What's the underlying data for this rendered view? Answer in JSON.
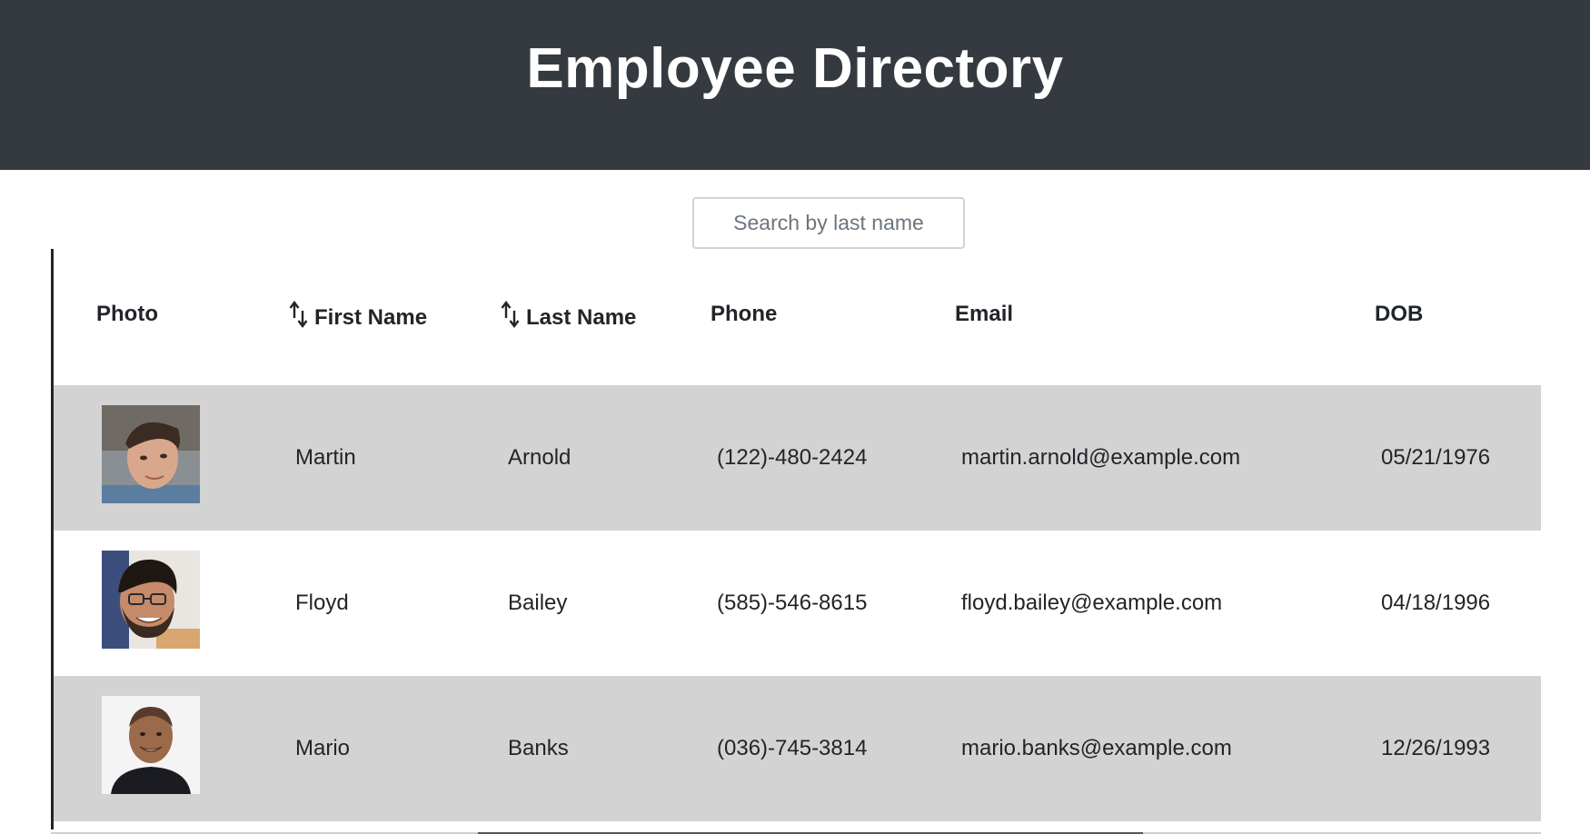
{
  "header": {
    "title": "Employee Directory"
  },
  "search": {
    "placeholder": "Search by last name",
    "value": ""
  },
  "table": {
    "columns": {
      "photo": "Photo",
      "first_name": "First Name",
      "last_name": "Last Name",
      "phone": "Phone",
      "email": "Email",
      "dob": "DOB"
    },
    "sort_icon": "sort-arrows-icon",
    "rows": [
      {
        "first": "Martin",
        "last": "Arnold",
        "phone": "(122)-480-2424",
        "email": "martin.arnold@example.com",
        "dob": "05/21/1976",
        "photo": "employee-photo"
      },
      {
        "first": "Floyd",
        "last": "Bailey",
        "phone": "(585)-546-8615",
        "email": "floyd.bailey@example.com",
        "dob": "04/18/1996",
        "photo": "employee-photo"
      },
      {
        "first": "Mario",
        "last": "Banks",
        "phone": "(036)-745-3814",
        "email": "mario.banks@example.com",
        "dob": "12/26/1993",
        "photo": "employee-photo"
      }
    ]
  },
  "colors": {
    "header_bg": "#343a40",
    "row_shade": "#d3d3d3",
    "text": "#212529"
  }
}
